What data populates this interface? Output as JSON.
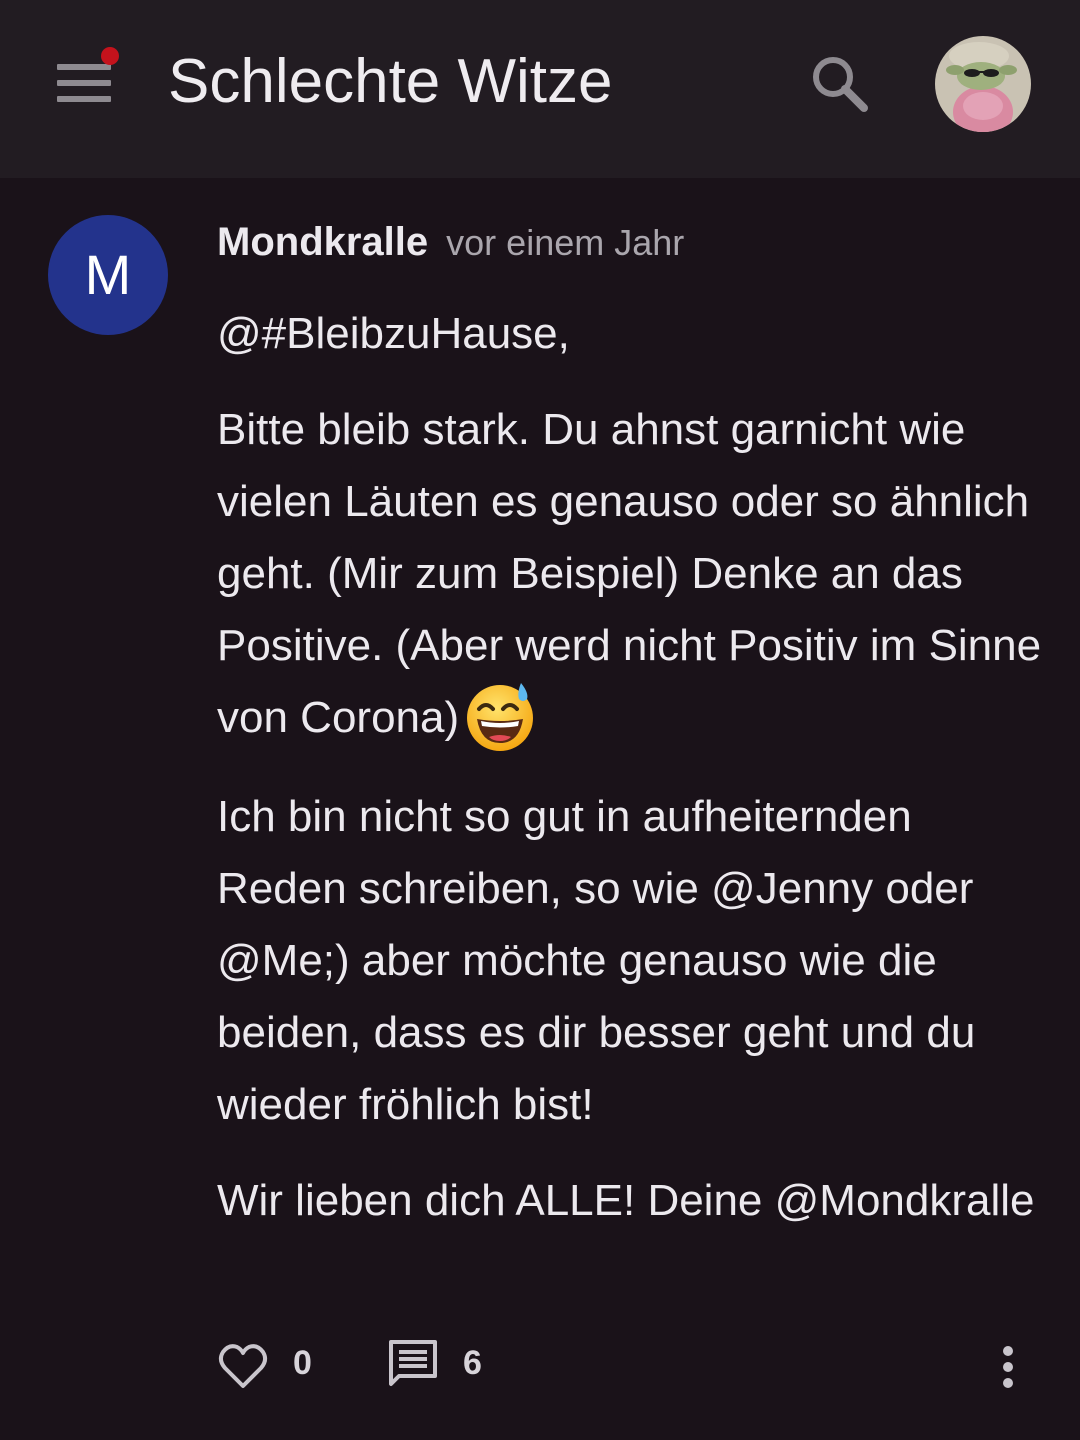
{
  "appbar": {
    "title": "Schlechte Witze",
    "menu_icon": "hamburger-menu-icon",
    "notification_dot_color": "#c4121c",
    "search_icon": "search-icon",
    "profile_avatar": "profile-avatar"
  },
  "comment": {
    "avatar_letter": "M",
    "avatar_color": "#23338c",
    "author": "Mondkralle",
    "timestamp": "vor einem Jahr",
    "paragraphs": [
      "@#BleibzuHause,",
      "Bitte bleib stark. Du ahnst garnicht wie vielen Läuten es genauso oder so ähnlich geht. (Mir zum Beispiel) Denke an das Positive. (Aber werd nicht Positiv im Sinne von Corona)",
      "Ich bin nicht so gut in aufheiternden Reden schreiben, so wie @Jenny oder @Me;) aber möchte genauso wie die beiden, dass es dir besser geht und du wieder fröhlich bist!",
      "Wir lieben dich ALLE! Deine @Mondkralle"
    ],
    "emoji": "grinning-face-with-sweat-emoji",
    "actions": {
      "like_icon": "heart-icon",
      "like_count": "0",
      "reply_icon": "comment-icon",
      "reply_count": "6",
      "more_icon": "more-vertical-icon"
    }
  }
}
